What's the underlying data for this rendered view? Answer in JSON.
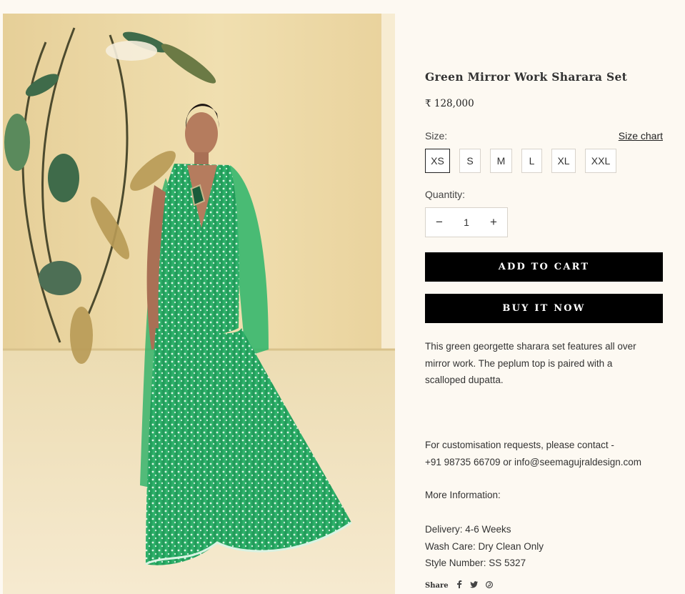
{
  "product": {
    "title": "Green Mirror Work Sharara Set",
    "price": "₹ 128,000",
    "image_alt": "Model wearing green mirror work sharara set"
  },
  "size_selector": {
    "label": "Size:",
    "chart_link": "Size chart",
    "options": [
      "XS",
      "S",
      "M",
      "L",
      "XL",
      "XXL"
    ],
    "selected": "XS"
  },
  "quantity": {
    "label": "Quantity:",
    "value": "1",
    "decrement_icon": "minus-icon",
    "increment_icon": "plus-icon"
  },
  "actions": {
    "add_to_cart": "ADD TO CART",
    "buy_now": "BUY IT NOW"
  },
  "description": {
    "lines": [
      "This green georgette sharara set features all over",
      "mirror work. The peplum top  is paired with a",
      "scalloped dupatta."
    ]
  },
  "contact": {
    "line1": "For customisation requests, please contact -",
    "line2": "+91 98735 66709 or info@seemagujraldesign.com"
  },
  "more_info": {
    "heading": "More Information:",
    "delivery": "Delivery: 4-6 Weeks",
    "wash_care": "Wash Care: Dry Clean Only",
    "style_number": "Style Number: SS 5327"
  },
  "share": {
    "label": "Share",
    "icons": [
      "facebook-icon",
      "twitter-icon",
      "pinterest-icon"
    ]
  },
  "colors": {
    "background": "#fdf9f2",
    "button": "#000000",
    "outfit_green": "#27a862"
  }
}
